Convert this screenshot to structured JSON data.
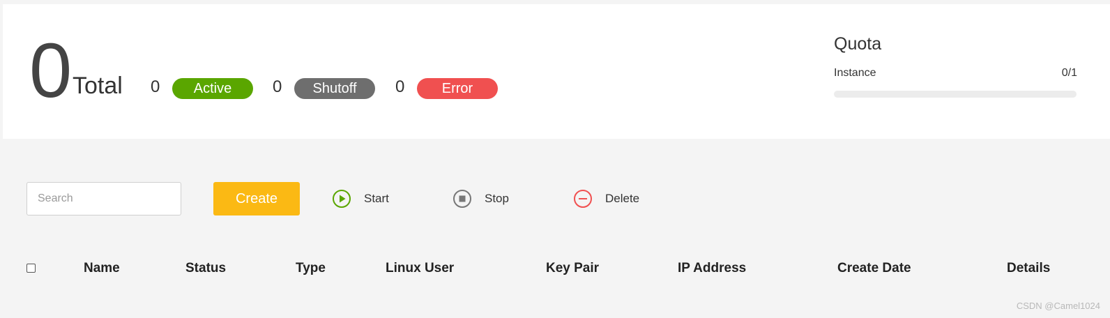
{
  "summary": {
    "total_count": "0",
    "total_label": "Total",
    "stats": [
      {
        "count": "0",
        "label": "Active",
        "color": "#5aa600"
      },
      {
        "count": "0",
        "label": "Shutoff",
        "color": "#6e6e6e"
      },
      {
        "count": "0",
        "label": "Error",
        "color": "#f05050"
      }
    ]
  },
  "quota": {
    "title": "Quota",
    "item_label": "Instance",
    "item_value": "0/1",
    "used_fraction": 0
  },
  "toolbar": {
    "search_placeholder": "Search",
    "create_label": "Create",
    "start_label": "Start",
    "stop_label": "Stop",
    "delete_label": "Delete"
  },
  "table": {
    "columns": [
      "Name",
      "Status",
      "Type",
      "Linux User",
      "Key Pair",
      "IP Address",
      "Create Date",
      "Details"
    ]
  },
  "watermark": "CSDN @Camel1024",
  "colors": {
    "active": "#5aa600",
    "shutoff": "#6e6e6e",
    "error": "#f05050",
    "create": "#fbb914"
  }
}
